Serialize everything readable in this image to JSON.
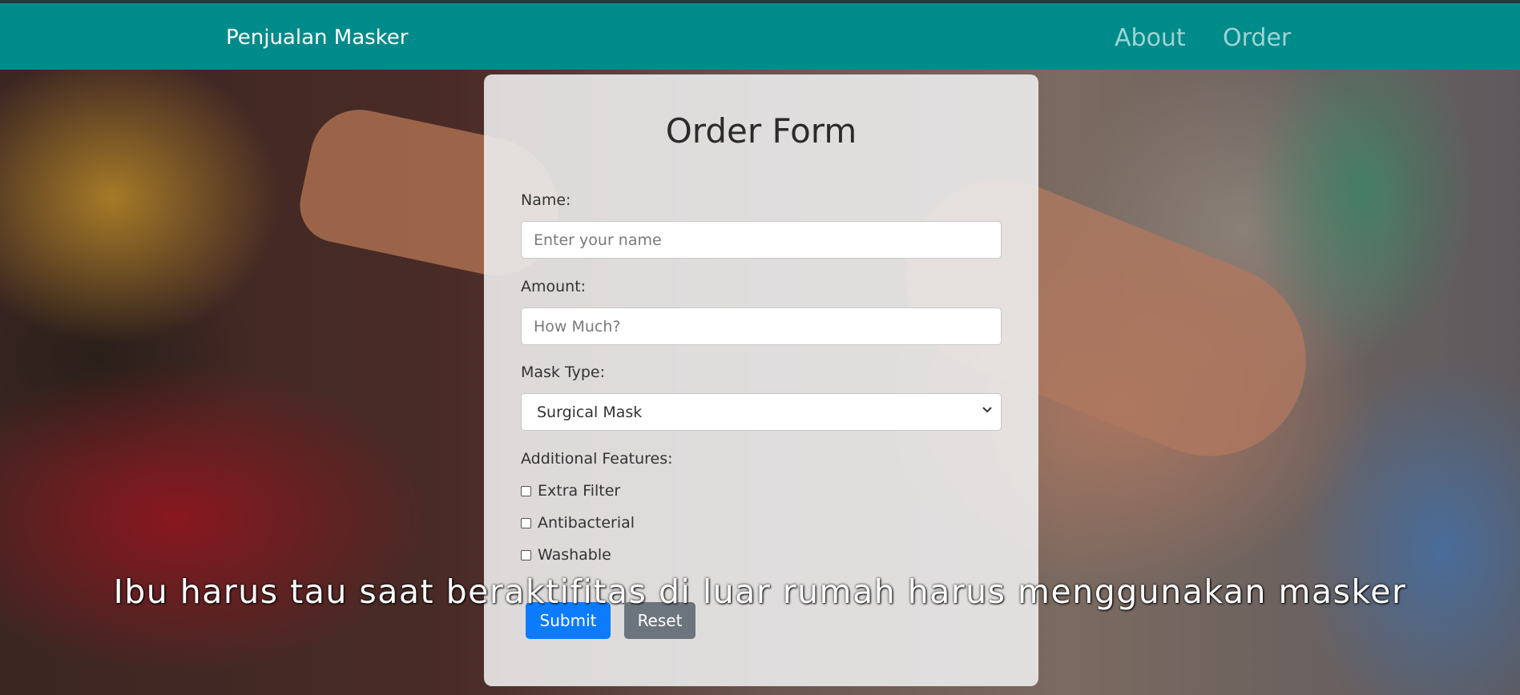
{
  "navbar": {
    "brand": "Penjualan Masker",
    "links": [
      {
        "label": "About"
      },
      {
        "label": "Order"
      }
    ]
  },
  "form": {
    "title": "Order Form",
    "name": {
      "label": "Name:",
      "placeholder": "Enter your name",
      "value": ""
    },
    "amount": {
      "label": "Amount:",
      "placeholder": "How Much?",
      "value": ""
    },
    "mask_type": {
      "label": "Mask Type:",
      "selected": "Surgical Mask"
    },
    "features": {
      "label": "Additional Features:",
      "options": [
        {
          "label": "Extra Filter",
          "checked": false
        },
        {
          "label": "Antibacterial",
          "checked": false
        },
        {
          "label": "Washable",
          "checked": false
        }
      ]
    },
    "submit_label": "Submit",
    "reset_label": "Reset"
  },
  "video": {
    "caption": "Ibu harus tau saat beraktifitas di luar rumah harus menggunakan masker"
  },
  "colors": {
    "navbar": "#008b8b",
    "submit": "#0d7bfd",
    "reset": "#6c757d"
  }
}
